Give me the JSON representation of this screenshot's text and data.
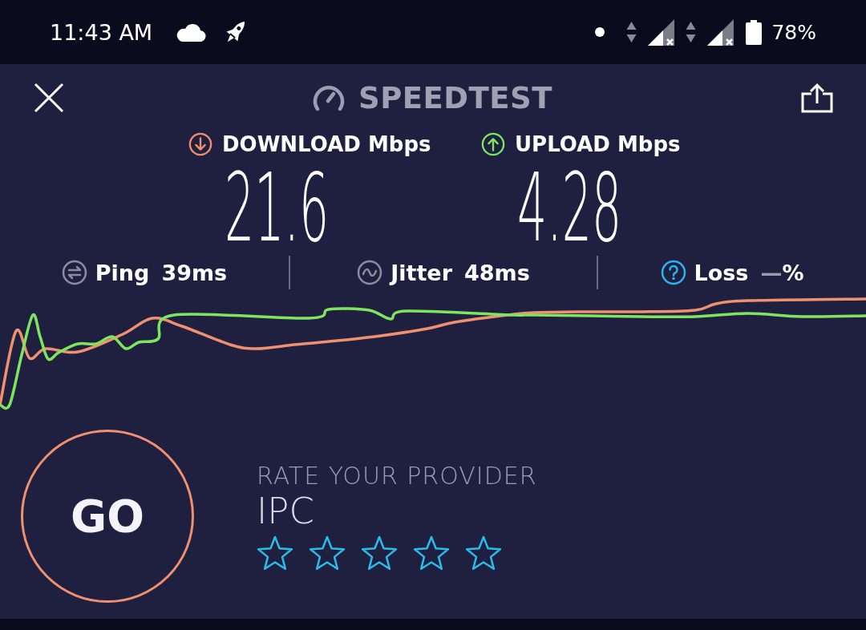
{
  "status_bar": {
    "time": "11:43 AM",
    "battery": "78%"
  },
  "header": {
    "title": "SPEEDTEST"
  },
  "results": [
    {
      "kind": "download",
      "label": "DOWNLOAD Mbps",
      "value": "21.6",
      "color": "#f0906f"
    },
    {
      "kind": "upload",
      "label": "UPLOAD Mbps",
      "value": "4.28",
      "color": "#7ee65e"
    }
  ],
  "metrics": [
    {
      "kind": "ping",
      "label": "Ping",
      "value": "39ms"
    },
    {
      "kind": "jitter",
      "label": "Jitter",
      "value": "48ms"
    },
    {
      "kind": "loss",
      "label": "Loss",
      "value": "—",
      "unit": "%"
    }
  ],
  "go_button": {
    "label": "GO"
  },
  "rating": {
    "prompt": "RATE YOUR PROVIDER",
    "provider": "IPC",
    "stars": 0
  }
}
